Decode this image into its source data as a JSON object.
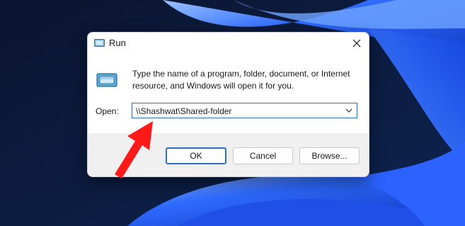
{
  "dialog": {
    "title": "Run",
    "title_icon": "run-icon",
    "close_icon": "close-icon",
    "description": "Type the name of a program, folder, document, or Internet resource, and Windows will open it for you.",
    "open_label": "Open:",
    "open_value": "\\\\Shashwat\\Shared-folder",
    "dropdown_icon": "chevron-down-icon"
  },
  "buttons": {
    "ok": "OK",
    "cancel": "Cancel",
    "browse": "Browse..."
  },
  "annotation": {
    "arrow_color": "#ff1a1a"
  },
  "colors": {
    "accent": "#2f6fbf",
    "wallpaper_blue": "#1e5eff"
  }
}
